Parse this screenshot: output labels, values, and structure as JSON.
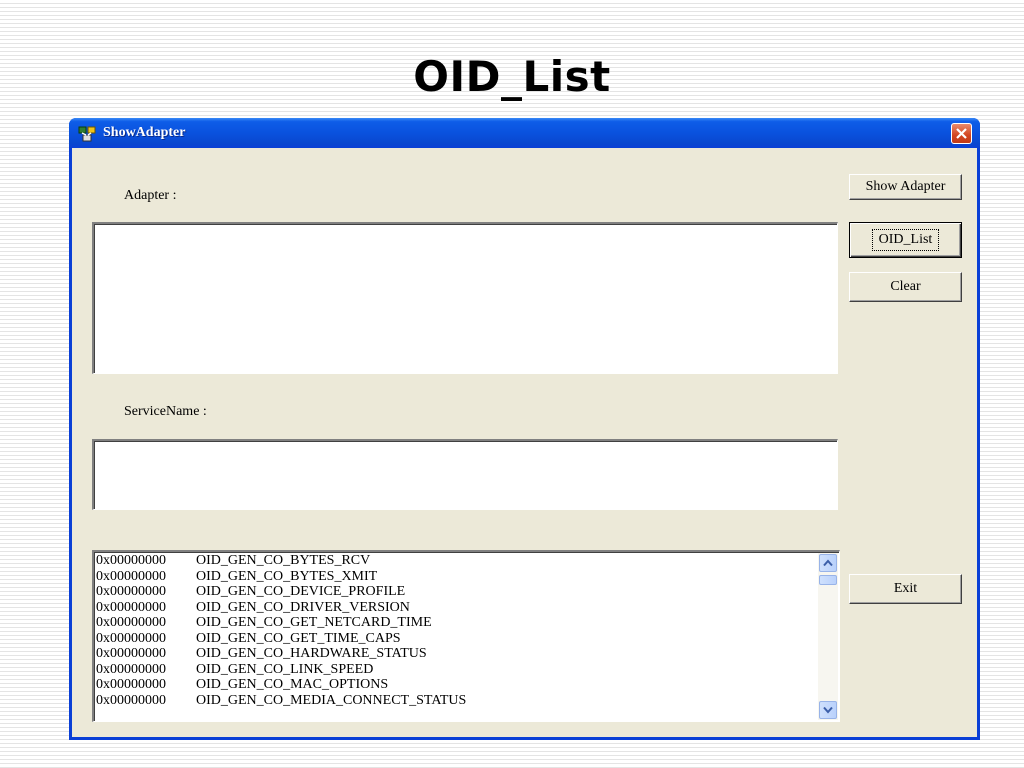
{
  "slide": {
    "title": "OID_List"
  },
  "window": {
    "title": "ShowAdapter"
  },
  "labels": {
    "adapter": "Adapter :",
    "service_name": "ServiceName :"
  },
  "adapter_box": {
    "value": ""
  },
  "service_box": {
    "value": ""
  },
  "buttons": {
    "show_adapter": "Show Adapter",
    "oid_list": "OID_List",
    "clear": "Clear",
    "exit": "Exit"
  },
  "oid_list": {
    "rows": [
      {
        "hex": "0x00000000",
        "name": "OID_GEN_CO_BYTES_RCV"
      },
      {
        "hex": "0x00000000",
        "name": "OID_GEN_CO_BYTES_XMIT"
      },
      {
        "hex": "0x00000000",
        "name": "OID_GEN_CO_DEVICE_PROFILE"
      },
      {
        "hex": "0x00000000",
        "name": "OID_GEN_CO_DRIVER_VERSION"
      },
      {
        "hex": "0x00000000",
        "name": "OID_GEN_CO_GET_NETCARD_TIME"
      },
      {
        "hex": "0x00000000",
        "name": "OID_GEN_CO_GET_TIME_CAPS"
      },
      {
        "hex": "0x00000000",
        "name": "OID_GEN_CO_HARDWARE_STATUS"
      },
      {
        "hex": "0x00000000",
        "name": "OID_GEN_CO_LINK_SPEED"
      },
      {
        "hex": "0x00000000",
        "name": "OID_GEN_CO_MAC_OPTIONS"
      },
      {
        "hex": "0x00000000",
        "name": "OID_GEN_CO_MEDIA_CONNECT_STATUS"
      }
    ]
  },
  "icons": {
    "app": "network-adapter-icon",
    "close": "close-icon",
    "scroll_up": "chevron-up-icon",
    "scroll_down": "chevron-down-icon"
  },
  "colors": {
    "titlebar": "#0a52de",
    "client_bg": "#ece9d8",
    "close_button": "#d2451f"
  }
}
